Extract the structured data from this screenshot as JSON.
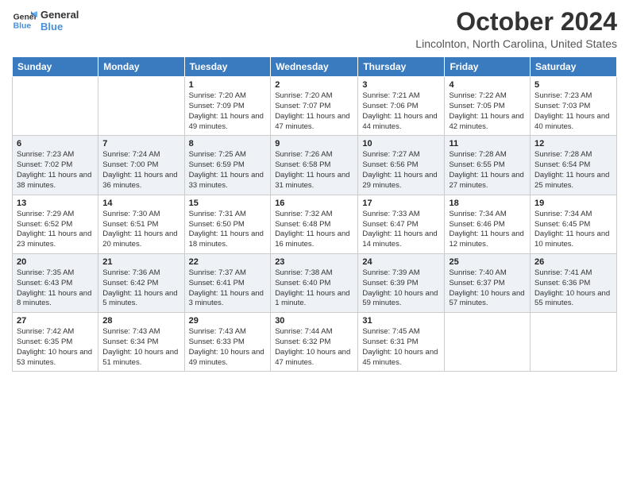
{
  "header": {
    "logo_line1": "General",
    "logo_line2": "Blue",
    "title": "October 2024",
    "subtitle": "Lincolnton, North Carolina, United States"
  },
  "days_of_week": [
    "Sunday",
    "Monday",
    "Tuesday",
    "Wednesday",
    "Thursday",
    "Friday",
    "Saturday"
  ],
  "weeks": [
    [
      {
        "day": "",
        "sunrise": "",
        "sunset": "",
        "daylight": ""
      },
      {
        "day": "",
        "sunrise": "",
        "sunset": "",
        "daylight": ""
      },
      {
        "day": "1",
        "sunrise": "Sunrise: 7:20 AM",
        "sunset": "Sunset: 7:09 PM",
        "daylight": "Daylight: 11 hours and 49 minutes."
      },
      {
        "day": "2",
        "sunrise": "Sunrise: 7:20 AM",
        "sunset": "Sunset: 7:07 PM",
        "daylight": "Daylight: 11 hours and 47 minutes."
      },
      {
        "day": "3",
        "sunrise": "Sunrise: 7:21 AM",
        "sunset": "Sunset: 7:06 PM",
        "daylight": "Daylight: 11 hours and 44 minutes."
      },
      {
        "day": "4",
        "sunrise": "Sunrise: 7:22 AM",
        "sunset": "Sunset: 7:05 PM",
        "daylight": "Daylight: 11 hours and 42 minutes."
      },
      {
        "day": "5",
        "sunrise": "Sunrise: 7:23 AM",
        "sunset": "Sunset: 7:03 PM",
        "daylight": "Daylight: 11 hours and 40 minutes."
      }
    ],
    [
      {
        "day": "6",
        "sunrise": "Sunrise: 7:23 AM",
        "sunset": "Sunset: 7:02 PM",
        "daylight": "Daylight: 11 hours and 38 minutes."
      },
      {
        "day": "7",
        "sunrise": "Sunrise: 7:24 AM",
        "sunset": "Sunset: 7:00 PM",
        "daylight": "Daylight: 11 hours and 36 minutes."
      },
      {
        "day": "8",
        "sunrise": "Sunrise: 7:25 AM",
        "sunset": "Sunset: 6:59 PM",
        "daylight": "Daylight: 11 hours and 33 minutes."
      },
      {
        "day": "9",
        "sunrise": "Sunrise: 7:26 AM",
        "sunset": "Sunset: 6:58 PM",
        "daylight": "Daylight: 11 hours and 31 minutes."
      },
      {
        "day": "10",
        "sunrise": "Sunrise: 7:27 AM",
        "sunset": "Sunset: 6:56 PM",
        "daylight": "Daylight: 11 hours and 29 minutes."
      },
      {
        "day": "11",
        "sunrise": "Sunrise: 7:28 AM",
        "sunset": "Sunset: 6:55 PM",
        "daylight": "Daylight: 11 hours and 27 minutes."
      },
      {
        "day": "12",
        "sunrise": "Sunrise: 7:28 AM",
        "sunset": "Sunset: 6:54 PM",
        "daylight": "Daylight: 11 hours and 25 minutes."
      }
    ],
    [
      {
        "day": "13",
        "sunrise": "Sunrise: 7:29 AM",
        "sunset": "Sunset: 6:52 PM",
        "daylight": "Daylight: 11 hours and 23 minutes."
      },
      {
        "day": "14",
        "sunrise": "Sunrise: 7:30 AM",
        "sunset": "Sunset: 6:51 PM",
        "daylight": "Daylight: 11 hours and 20 minutes."
      },
      {
        "day": "15",
        "sunrise": "Sunrise: 7:31 AM",
        "sunset": "Sunset: 6:50 PM",
        "daylight": "Daylight: 11 hours and 18 minutes."
      },
      {
        "day": "16",
        "sunrise": "Sunrise: 7:32 AM",
        "sunset": "Sunset: 6:48 PM",
        "daylight": "Daylight: 11 hours and 16 minutes."
      },
      {
        "day": "17",
        "sunrise": "Sunrise: 7:33 AM",
        "sunset": "Sunset: 6:47 PM",
        "daylight": "Daylight: 11 hours and 14 minutes."
      },
      {
        "day": "18",
        "sunrise": "Sunrise: 7:34 AM",
        "sunset": "Sunset: 6:46 PM",
        "daylight": "Daylight: 11 hours and 12 minutes."
      },
      {
        "day": "19",
        "sunrise": "Sunrise: 7:34 AM",
        "sunset": "Sunset: 6:45 PM",
        "daylight": "Daylight: 11 hours and 10 minutes."
      }
    ],
    [
      {
        "day": "20",
        "sunrise": "Sunrise: 7:35 AM",
        "sunset": "Sunset: 6:43 PM",
        "daylight": "Daylight: 11 hours and 8 minutes."
      },
      {
        "day": "21",
        "sunrise": "Sunrise: 7:36 AM",
        "sunset": "Sunset: 6:42 PM",
        "daylight": "Daylight: 11 hours and 5 minutes."
      },
      {
        "day": "22",
        "sunrise": "Sunrise: 7:37 AM",
        "sunset": "Sunset: 6:41 PM",
        "daylight": "Daylight: 11 hours and 3 minutes."
      },
      {
        "day": "23",
        "sunrise": "Sunrise: 7:38 AM",
        "sunset": "Sunset: 6:40 PM",
        "daylight": "Daylight: 11 hours and 1 minute."
      },
      {
        "day": "24",
        "sunrise": "Sunrise: 7:39 AM",
        "sunset": "Sunset: 6:39 PM",
        "daylight": "Daylight: 10 hours and 59 minutes."
      },
      {
        "day": "25",
        "sunrise": "Sunrise: 7:40 AM",
        "sunset": "Sunset: 6:37 PM",
        "daylight": "Daylight: 10 hours and 57 minutes."
      },
      {
        "day": "26",
        "sunrise": "Sunrise: 7:41 AM",
        "sunset": "Sunset: 6:36 PM",
        "daylight": "Daylight: 10 hours and 55 minutes."
      }
    ],
    [
      {
        "day": "27",
        "sunrise": "Sunrise: 7:42 AM",
        "sunset": "Sunset: 6:35 PM",
        "daylight": "Daylight: 10 hours and 53 minutes."
      },
      {
        "day": "28",
        "sunrise": "Sunrise: 7:43 AM",
        "sunset": "Sunset: 6:34 PM",
        "daylight": "Daylight: 10 hours and 51 minutes."
      },
      {
        "day": "29",
        "sunrise": "Sunrise: 7:43 AM",
        "sunset": "Sunset: 6:33 PM",
        "daylight": "Daylight: 10 hours and 49 minutes."
      },
      {
        "day": "30",
        "sunrise": "Sunrise: 7:44 AM",
        "sunset": "Sunset: 6:32 PM",
        "daylight": "Daylight: 10 hours and 47 minutes."
      },
      {
        "day": "31",
        "sunrise": "Sunrise: 7:45 AM",
        "sunset": "Sunset: 6:31 PM",
        "daylight": "Daylight: 10 hours and 45 minutes."
      },
      {
        "day": "",
        "sunrise": "",
        "sunset": "",
        "daylight": ""
      },
      {
        "day": "",
        "sunrise": "",
        "sunset": "",
        "daylight": ""
      }
    ]
  ]
}
